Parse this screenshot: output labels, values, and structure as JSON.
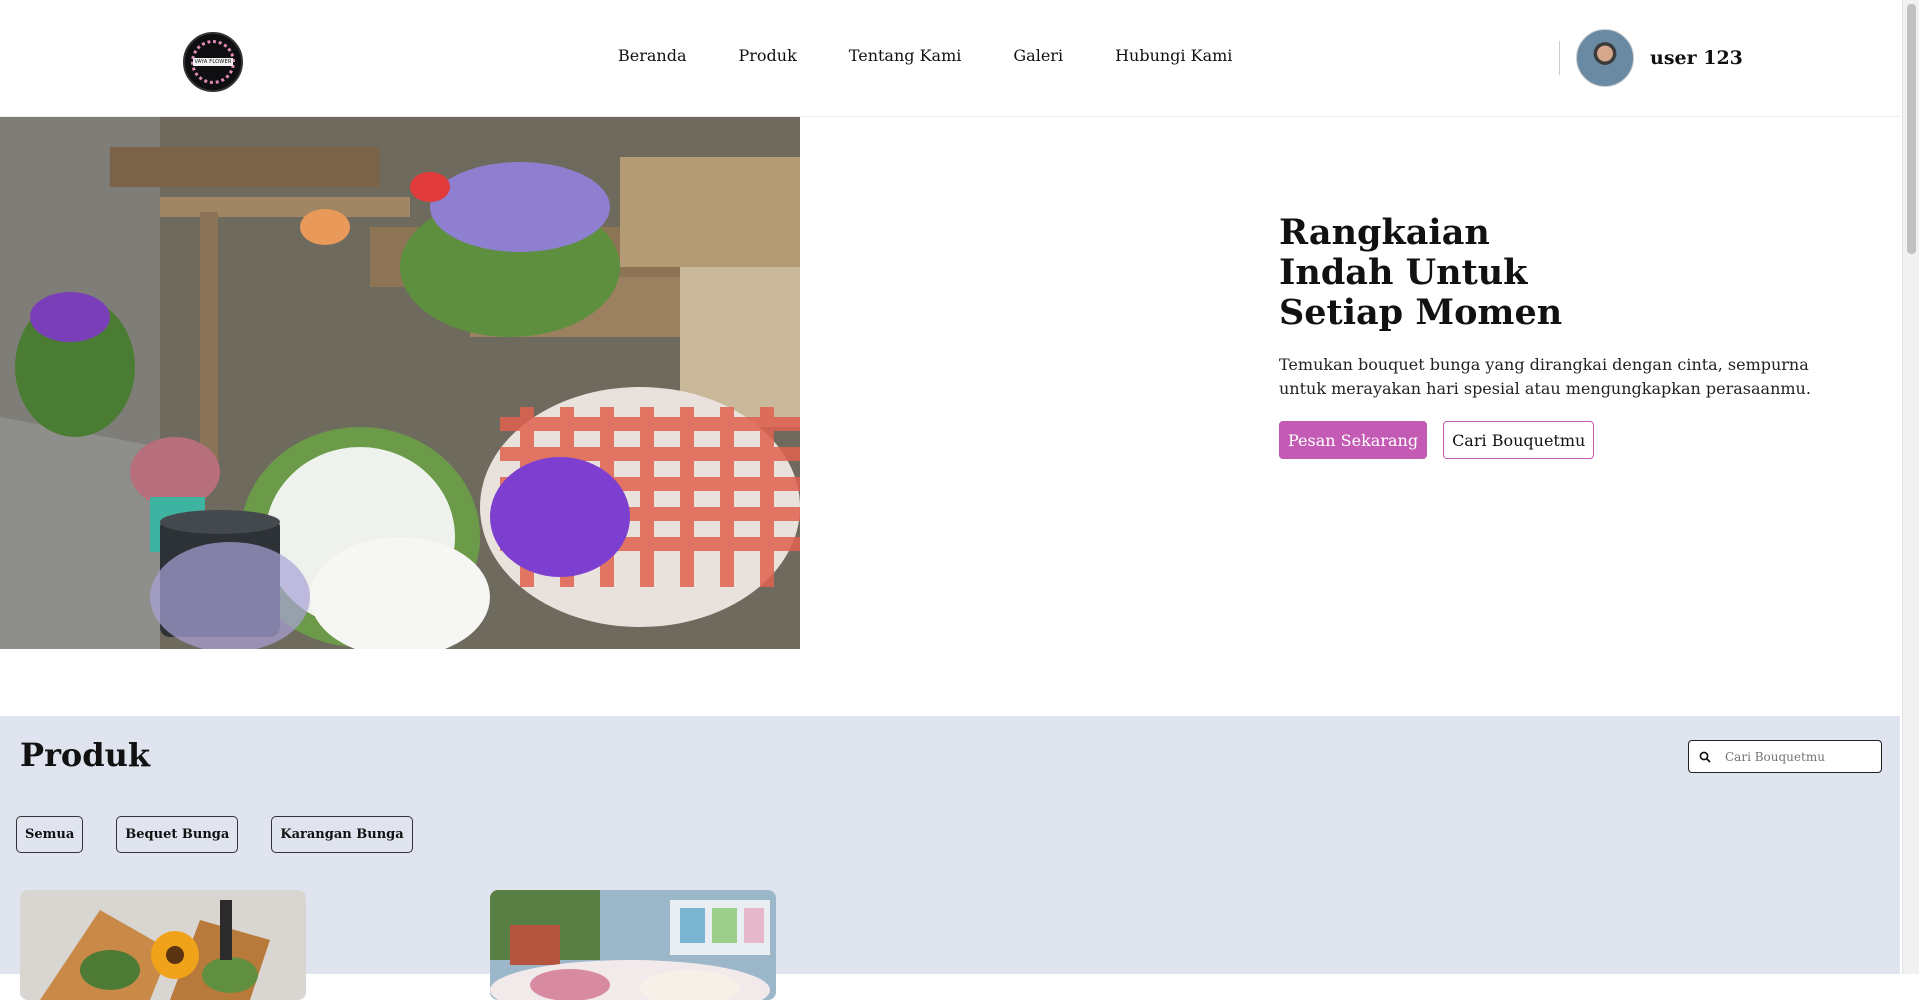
{
  "header": {
    "logo_text": "VAYA FLOWER",
    "nav": [
      {
        "label": "Beranda"
      },
      {
        "label": "Produk"
      },
      {
        "label": "Tentang Kami"
      },
      {
        "label": "Galeri"
      },
      {
        "label": "Hubungi Kami"
      }
    ],
    "user": {
      "name": "user 123"
    }
  },
  "hero": {
    "title": "Rangkaian Indah Untuk Setiap Momen",
    "description": "Temukan bouquet bunga yang dirangkai dengan cinta, sempurna untuk merayakan hari spesial atau mengungkapkan perasaanmu.",
    "primary_button": "Pesan Sekarang",
    "secondary_button": "Cari Bouquetmu"
  },
  "products": {
    "title": "Produk",
    "search_placeholder": "Cari Bouquetmu",
    "filters": [
      {
        "label": "Semua"
      },
      {
        "label": "Bequet Bunga"
      },
      {
        "label": "Karangan Bunga"
      }
    ]
  },
  "colors": {
    "accent": "#c35ab3",
    "products_bg": "#dfe4ee"
  },
  "icons": [
    "search-icon"
  ]
}
